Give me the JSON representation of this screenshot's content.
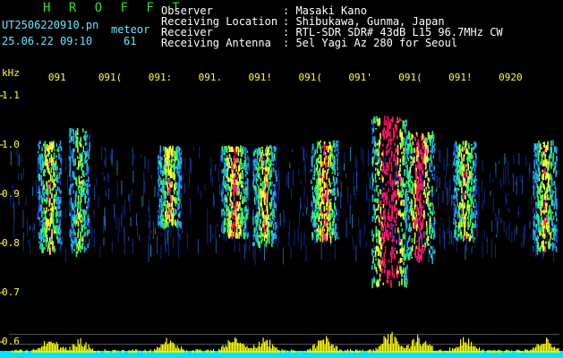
{
  "header": {
    "brand": "H R O F F T",
    "filename": "UT2506220910.pn",
    "meteor_label": "meteor",
    "datetime": "25.06.22 09:10",
    "count": "61",
    "fields": [
      {
        "label": "Observer",
        "value": ": Masaki Kano"
      },
      {
        "label": "Receiving Location",
        "value": ": Shibukawa, Gunma, Japan"
      },
      {
        "label": "Receiver",
        "value": ": RTL-SDR SDR# 43dB L15 96.7MHz CW"
      },
      {
        "label": "Receiving Antenna",
        "value": ": 5el Yagi Az 280 for Seoul"
      }
    ]
  },
  "colors": {
    "brand": "#33dd33",
    "text": "#66e6ff",
    "header_values": "#ffffff",
    "ticks": "#ffff33",
    "echo_strong": "#ff2277",
    "echo_weak": "#1144cc",
    "power_trace": "#ffff00",
    "noise_floor": "#00e5ff"
  },
  "chart_data": {
    "type": "heatmap",
    "xlabel": "",
    "ylabel": "kHz",
    "x_ticks": [
      "091",
      "091(",
      "091:",
      "091.",
      "091!",
      "091(",
      "091'",
      "091(",
      "091!",
      "0920"
    ],
    "y_ticks": [
      "1.1",
      "1.0",
      "0.9",
      "0.8",
      "0.7",
      "0.6"
    ],
    "ylim": [
      0.6,
      1.1
    ],
    "x_range_minutes": [
      "09:10",
      "09:20"
    ],
    "bursts": [
      {
        "t": 9.8,
        "f_center": 0.9,
        "f_span": 0.22,
        "intensity": 0.6
      },
      {
        "t": 10.4,
        "f_center": 0.91,
        "f_span": 0.25,
        "intensity": 0.5
      },
      {
        "t": 12.2,
        "f_center": 0.92,
        "f_span": 0.16,
        "intensity": 0.6
      },
      {
        "t": 13.5,
        "f_center": 0.91,
        "f_span": 0.18,
        "intensity": 0.7
      },
      {
        "t": 14.1,
        "f_center": 0.9,
        "f_span": 0.2,
        "intensity": 0.6
      },
      {
        "t": 15.3,
        "f_center": 0.91,
        "f_span": 0.2,
        "intensity": 0.7
      },
      {
        "t": 16.6,
        "f_center": 0.89,
        "f_span": 0.34,
        "intensity": 1.0
      },
      {
        "t": 17.2,
        "f_center": 0.9,
        "f_span": 0.26,
        "intensity": 0.8
      },
      {
        "t": 18.1,
        "f_center": 0.91,
        "f_span": 0.2,
        "intensity": 0.6
      },
      {
        "t": 19.7,
        "f_center": 0.9,
        "f_span": 0.22,
        "intensity": 0.6
      }
    ]
  }
}
